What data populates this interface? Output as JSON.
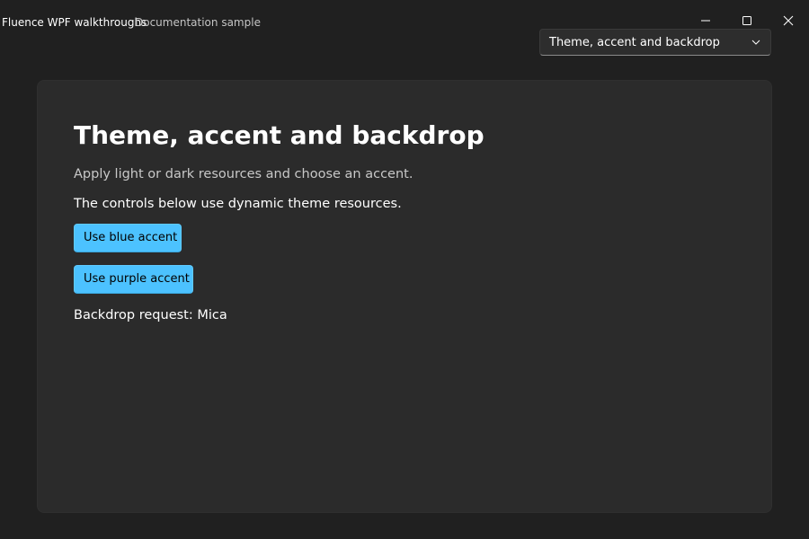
{
  "window": {
    "title": "Fluence WPF walkthroughs",
    "subtitle": "Documentation sample",
    "controls": {
      "minimize_icon": "minimize-icon",
      "maximize_icon": "maximize-icon",
      "close_icon": "close-icon"
    }
  },
  "navigation": {
    "selected_page": "Theme, accent and backdrop",
    "dropdown_icon": "chevron-down-icon"
  },
  "page": {
    "title": "Theme, accent and backdrop",
    "subtitle": "Apply light or dark resources and choose an accent.",
    "description": "The controls below use dynamic theme resources.",
    "buttons": {
      "blue_accent": "Use blue accent",
      "purple_accent": "Use purple accent"
    },
    "backdrop_status": "Backdrop request: Mica"
  },
  "colors": {
    "window_background": "#202020",
    "card_background": "#2b2b2b",
    "accent": "#4cc2ff",
    "primary_text": "#ffffff",
    "secondary_text": "#c8c8c8"
  }
}
